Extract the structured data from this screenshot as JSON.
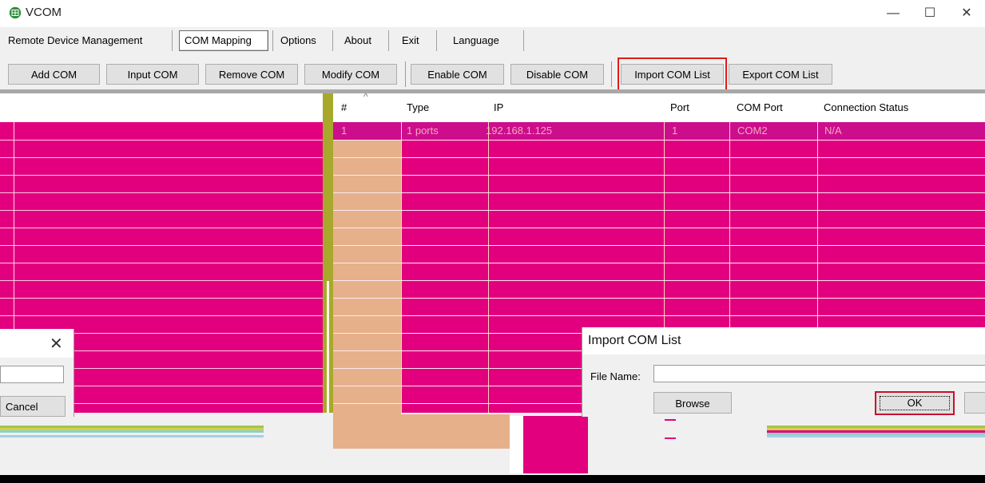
{
  "window": {
    "title": "VCOM",
    "controls": [
      "—",
      "☐",
      "✕"
    ]
  },
  "menu": {
    "items": [
      "Remote Device Management",
      "COM Mapping",
      "Options",
      "About",
      "Exit",
      "Language"
    ],
    "active": "COM Mapping"
  },
  "toolbar": {
    "buttons": [
      "Add COM",
      "Input COM",
      "Remove COM",
      "Modify COM",
      "Enable COM",
      "Disable COM",
      "Import COM List",
      "Export COM List"
    ],
    "highlighted": "Import COM List",
    "highlight_color": "#e21b1b"
  },
  "table": {
    "sort_indicator": "^",
    "columns": [
      "#",
      "Type",
      "IP",
      "Port",
      "COM Port",
      "Connection Status"
    ],
    "rows": [
      {
        "num": "1",
        "type": "1 ports",
        "ip": "192.168.1.125",
        "port": "1",
        "com_port": "COM2",
        "status": "N/A"
      }
    ]
  },
  "cancel_dialog": {
    "close_symbol": "✕",
    "cancel_label": "Cancel"
  },
  "import_dialog": {
    "title": "Import COM List",
    "file_name_label": "File Name:",
    "file_name_value": "",
    "browse_label": "Browse",
    "ok_label": "OK"
  },
  "colors": {
    "table_bg": "#e3007f",
    "selected_row": "#cc0e8c",
    "first_column": "#e6b08a",
    "splitter": "#a8a82c"
  }
}
